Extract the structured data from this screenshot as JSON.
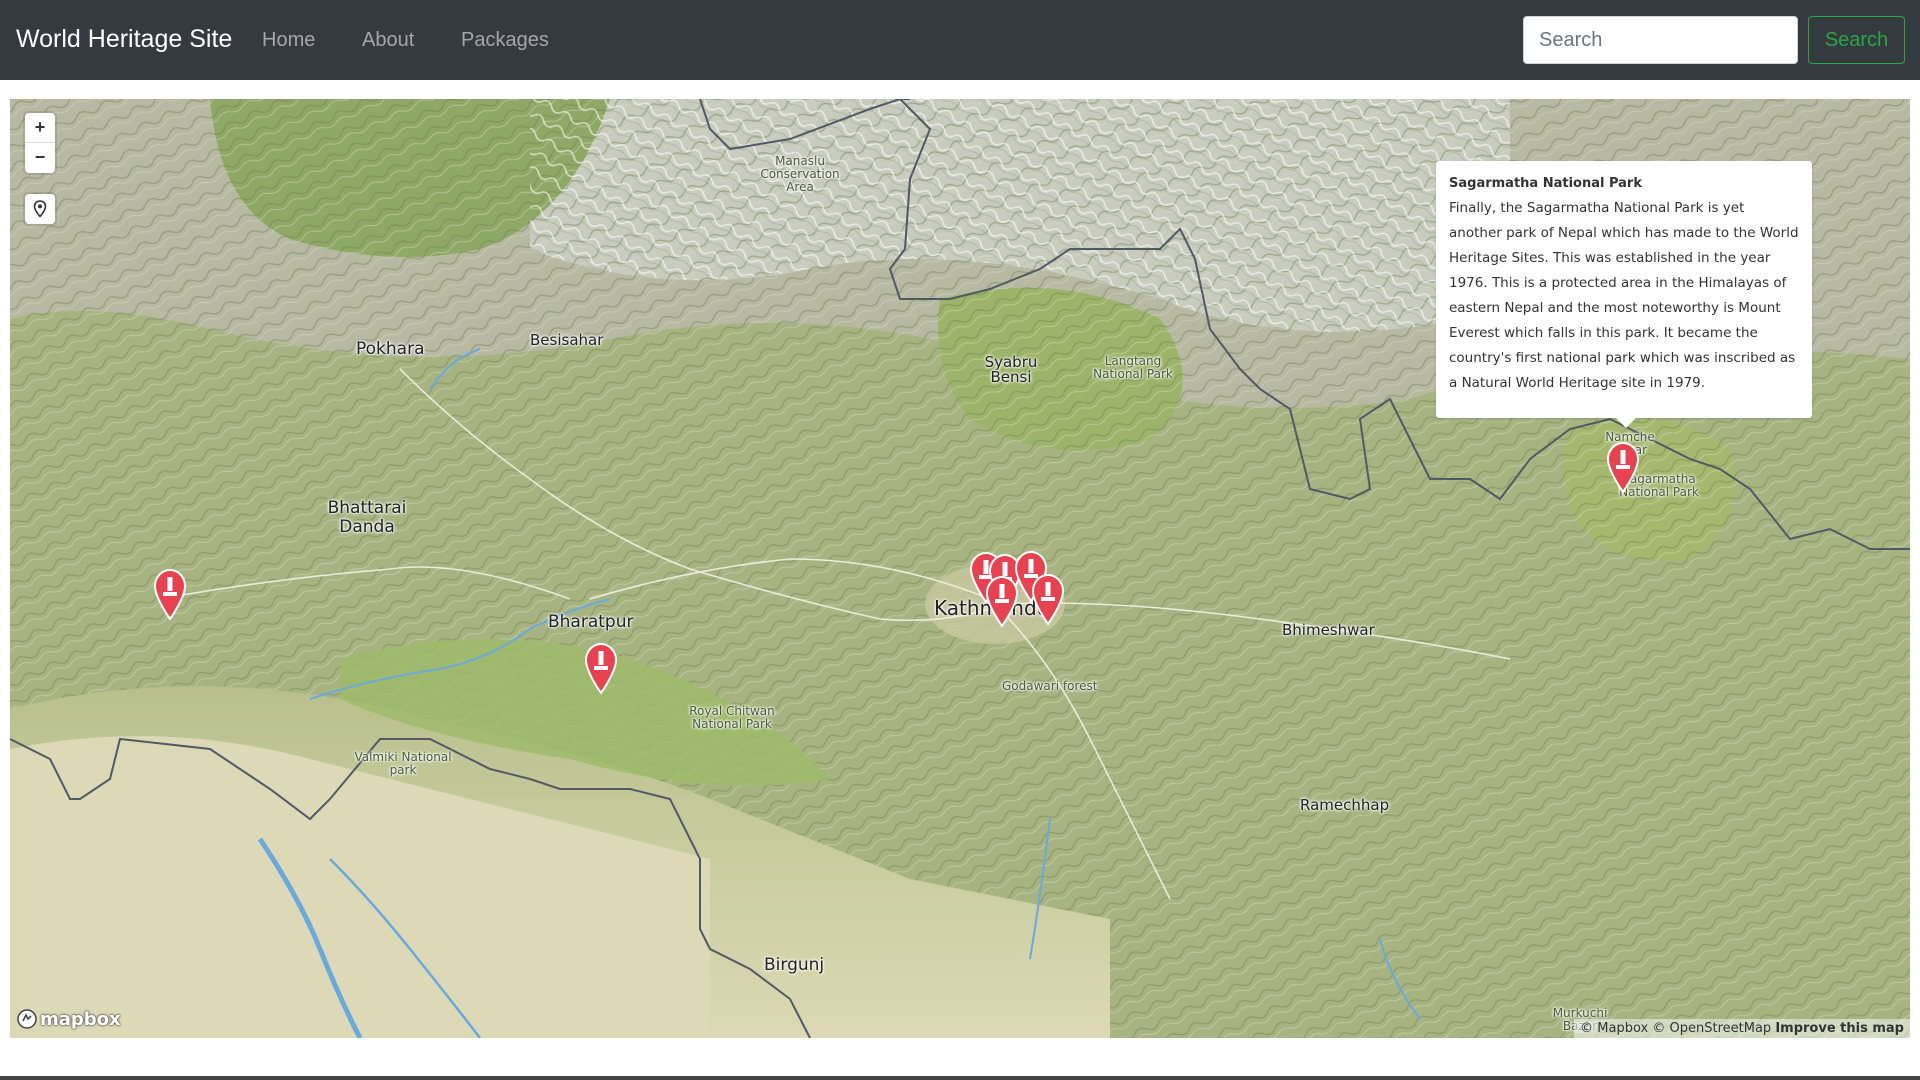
{
  "nav": {
    "brand": "World Heritage Site",
    "links": [
      "Home",
      "About",
      "Packages"
    ],
    "search_placeholder": "Search",
    "search_button": "Search"
  },
  "map": {
    "controls": {
      "zoom_in": "+",
      "zoom_out": "−",
      "locate_icon": "map-pin-icon"
    },
    "places": {
      "pokhara": "Pokhara",
      "besisahar": "Besisahar",
      "manaslu": "Manaslu Conservation Area",
      "syabru": "Syabru Bensi",
      "langtang": "Langtang National Park",
      "bhattarai": "Bhattarai Danda",
      "bharatpur": "Bharatpur",
      "chitwan": "Royal Chitwan National Park",
      "valmiki": "Valmiki National park",
      "kathmandu": "Kathmandu",
      "godawari": "Godawari forest",
      "bhimeshwar": "Bhimeshwar",
      "ramechhap": "Ramechhap",
      "birgunj": "Birgunj",
      "sagarmatha_label": "Sagarmatha National Park",
      "namche": "Namche Bazar",
      "murkuchi": "Murkuchi Bazar"
    },
    "marker_icon": "monument-marker-icon",
    "marker_color": "#e8414f",
    "popup": {
      "title": "Sagarmatha National Park",
      "body": "Finally, the Sagarmatha National Park is yet another park of Nepal which has made to the World Heritage Sites. This was established in the year 1976. This is a protected area in the Himalayas of eastern Nepal and the most noteworthy is Mount Everest which falls in this park. It became the country's first national park which was inscribed as a Natural World Heritage site in 1979."
    },
    "logo_text": "mapbox",
    "attribution": {
      "mapbox": "© Mapbox",
      "osm": "© OpenStreetMap",
      "improve": "Improve this map"
    }
  },
  "colors": {
    "navbar_bg": "#343a40",
    "search_accent": "#28a745"
  }
}
